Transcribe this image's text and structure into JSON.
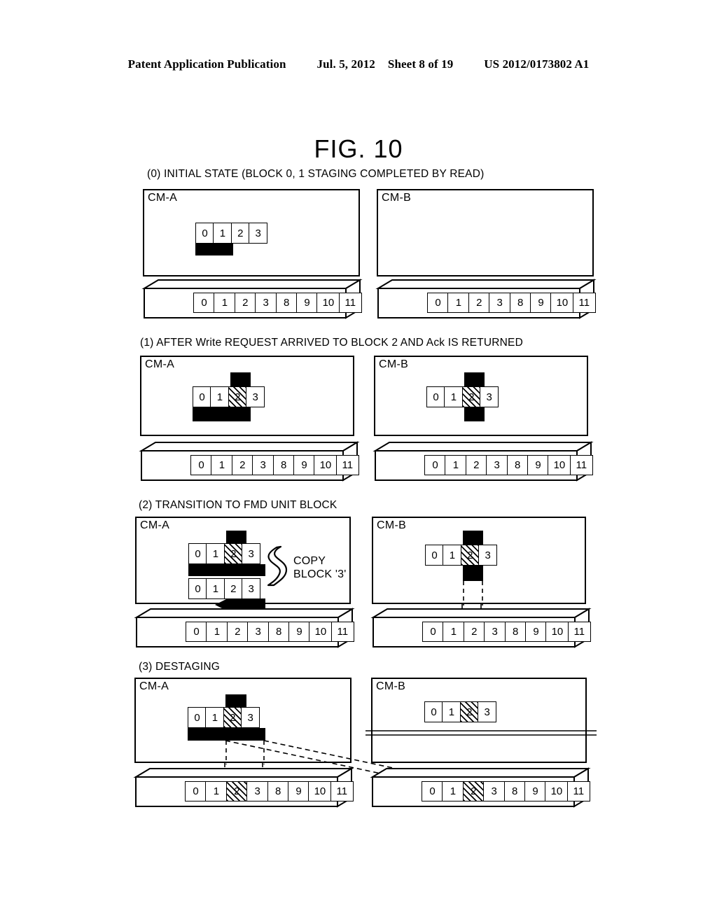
{
  "header": {
    "publication": "Patent Application Publication",
    "date": "Jul. 5, 2012",
    "sheet": "Sheet 8 of 19",
    "docnum": "US 2012/0173802 A1"
  },
  "figure": {
    "title": "FIG. 10"
  },
  "labels": {
    "cm_a": "CM-A",
    "cm_b": "CM-B",
    "copy_block": "COPY\nBLOCK '3'",
    "copy_block_line1": "COPY",
    "copy_block_line2": "BLOCK '3'"
  },
  "cache_cells": [
    "0",
    "1",
    "2",
    "3"
  ],
  "drive_cells": [
    "0",
    "1",
    "2",
    "3",
    "8",
    "9",
    "10",
    "11"
  ],
  "sections": [
    {
      "id": "s0",
      "caption": "(0) INITIAL STATE (BLOCK 0, 1 STAGING COMPLETED BY READ)",
      "panels": [
        {
          "name": "cm-a",
          "label": "CM-A",
          "cache_rows": [
            {
              "cells": [
                "0",
                "1",
                "2",
                "3"
              ],
              "hatched": [],
              "bar_below": [
                0,
                1
              ],
              "bar_above": []
            }
          ],
          "drive": {
            "cells": [
              "0",
              "1",
              "2",
              "3",
              "8",
              "9",
              "10",
              "11"
            ],
            "hatched": []
          },
          "arrows": []
        },
        {
          "name": "cm-b",
          "label": "CM-B",
          "cache_rows": [],
          "drive": {
            "cells": [
              "0",
              "1",
              "2",
              "3",
              "8",
              "9",
              "10",
              "11"
            ],
            "hatched": []
          },
          "arrows": []
        }
      ]
    },
    {
      "id": "s1",
      "caption": "(1) AFTER Write REQUEST ARRIVED TO BLOCK 2 AND Ack IS RETURNED",
      "panels": [
        {
          "name": "cm-a",
          "label": "CM-A",
          "cache_rows": [
            {
              "cells": [
                "0",
                "1",
                "2",
                "3"
              ],
              "hatched": [
                2
              ],
              "bar_below": [
                0,
                1,
                2
              ],
              "bar_above": [
                2
              ]
            }
          ],
          "drive": {
            "cells": [
              "0",
              "1",
              "2",
              "3",
              "8",
              "9",
              "10",
              "11"
            ],
            "hatched": []
          },
          "arrows": []
        },
        {
          "name": "cm-b",
          "label": "CM-B",
          "cache_rows": [
            {
              "cells": [
                "0",
                "1",
                "2",
                "3"
              ],
              "hatched": [
                2
              ],
              "bar_below": [
                2
              ],
              "bar_above": [
                2
              ]
            }
          ],
          "drive": {
            "cells": [
              "0",
              "1",
              "2",
              "3",
              "8",
              "9",
              "10",
              "11"
            ],
            "hatched": []
          },
          "arrows": []
        }
      ]
    },
    {
      "id": "s2",
      "caption": "(2) TRANSITION TO FMD UNIT BLOCK",
      "panels": [
        {
          "name": "cm-a",
          "label": "CM-A",
          "cache_rows": [
            {
              "cells": [
                "0",
                "1",
                "2",
                "3"
              ],
              "hatched": [
                2
              ],
              "bar_below": [
                0,
                1,
                2,
                3
              ],
              "bar_above": [
                2
              ]
            },
            {
              "cells": [
                "0",
                "1",
                "2",
                "3"
              ],
              "hatched": [],
              "bar_below": [
                2,
                3
              ],
              "bar_above": []
            }
          ],
          "drive": {
            "cells": [
              "0",
              "1",
              "2",
              "3",
              "8",
              "9",
              "10",
              "11"
            ],
            "hatched": []
          },
          "annotation": "COPY BLOCK '3'",
          "arrows": [
            "stage-up-2",
            "stage-up-3"
          ]
        },
        {
          "name": "cm-b",
          "label": "CM-B",
          "cache_rows": [
            {
              "cells": [
                "0",
                "1",
                "2",
                "3"
              ],
              "hatched": [
                2
              ],
              "bar_below": [
                2
              ],
              "bar_above": [
                2
              ]
            }
          ],
          "drive": {
            "cells": [
              "0",
              "1",
              "2",
              "3",
              "8",
              "9",
              "10",
              "11"
            ],
            "hatched": []
          },
          "arrows": [
            "dashed-down-2-left",
            "dashed-down-2-right"
          ]
        }
      ]
    },
    {
      "id": "s3",
      "caption": "(3) DESTAGING",
      "panels": [
        {
          "name": "cm-a",
          "label": "CM-A",
          "cache_rows": [
            {
              "cells": [
                "0",
                "1",
                "2",
                "3"
              ],
              "hatched": [
                2
              ],
              "bar_below": [
                0,
                1,
                2,
                3
              ],
              "bar_above": [
                2
              ]
            }
          ],
          "drive": {
            "cells": [
              "0",
              "1",
              "2",
              "3",
              "8",
              "9",
              "10",
              "11"
            ],
            "hatched": [
              2
            ]
          },
          "arrows": [
            "dashed-down-2",
            "dashed-down-3",
            "dashed-cross-to-b-1",
            "dashed-cross-to-b-2"
          ]
        },
        {
          "name": "cm-b",
          "label": "CM-B",
          "cache_rows": [
            {
              "cells": [
                "0",
                "1",
                "2",
                "3"
              ],
              "hatched": [
                2
              ],
              "bar_below": [],
              "bar_above": [],
              "struck": true
            }
          ],
          "drive": {
            "cells": [
              "0",
              "1",
              "2",
              "3",
              "8",
              "9",
              "10",
              "11"
            ],
            "hatched": [
              2
            ]
          },
          "arrows": [
            "incoming-dashed-2",
            "incoming-dashed-3"
          ]
        }
      ]
    }
  ]
}
